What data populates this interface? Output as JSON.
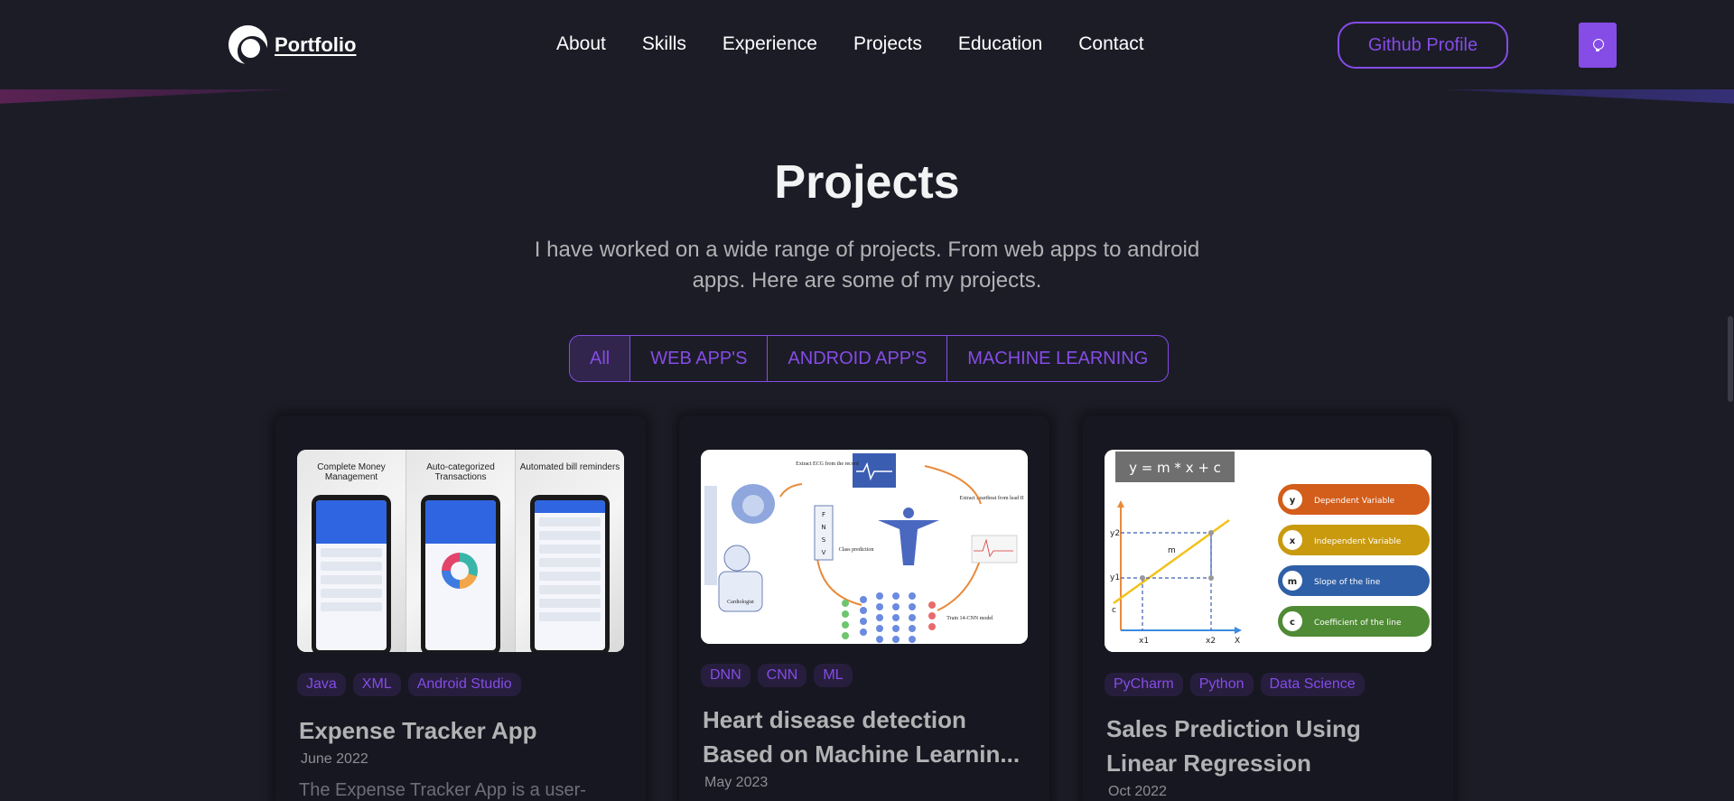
{
  "header": {
    "logo_text": "Portfolio",
    "nav": [
      "About",
      "Skills",
      "Experience",
      "Projects",
      "Education",
      "Contact"
    ],
    "github_button": "Github Profile",
    "theme_icon": "lightbulb-icon"
  },
  "section": {
    "title": "Projects",
    "description": "I have worked on a wide range of projects. From web apps to android apps. Here are some of my projects.",
    "filters": [
      "All",
      "WEB APP'S",
      "ANDROID APP'S",
      "MACHINE LEARNING"
    ],
    "active_filter": "All"
  },
  "colors": {
    "background": "#1c1c27",
    "card": "#171721",
    "accent": "#854ce6",
    "text_primary": "#f2f3f4",
    "text_secondary": "#b1b2b3"
  },
  "projects": [
    {
      "image_captions": [
        "Complete Money Management",
        "Auto-categorized Transactions",
        "Automated bill reminders"
      ],
      "tags": [
        "Java",
        "XML",
        "Android Studio"
      ],
      "title": "Expense Tracker App",
      "date": "June 2022",
      "description": "The Expense Tracker App is a user-"
    },
    {
      "image_labels": [
        "Extract ECG from the record",
        "Extract heartbeat from lead II",
        "Class prediction",
        "Cardiologist",
        "Train 14-CNN model",
        "F",
        "N",
        "S",
        "V"
      ],
      "tags": [
        "DNN",
        "CNN",
        "ML"
      ],
      "title": "Heart disease detection Based on Machine Learnin...",
      "date": "May 2023"
    },
    {
      "image_equation": "y = m * x + c",
      "image_legend": [
        {
          "key": "y",
          "label": "Dependent Variable",
          "color": "#d35d1a"
        },
        {
          "key": "x",
          "label": "Independent Variable",
          "color": "#c99a0e"
        },
        {
          "key": "m",
          "label": "Slope of the line",
          "color": "#2f5fa6"
        },
        {
          "key": "c",
          "label": "Coefficient of the line",
          "color": "#4f8a34"
        }
      ],
      "image_axis_labels": [
        "y2",
        "y1",
        "c",
        "x1",
        "x2",
        "X",
        "m"
      ],
      "tags": [
        "PyCharm",
        "Python",
        "Data Science"
      ],
      "title": "Sales Prediction Using Linear Regression",
      "date": "Oct 2022"
    }
  ]
}
